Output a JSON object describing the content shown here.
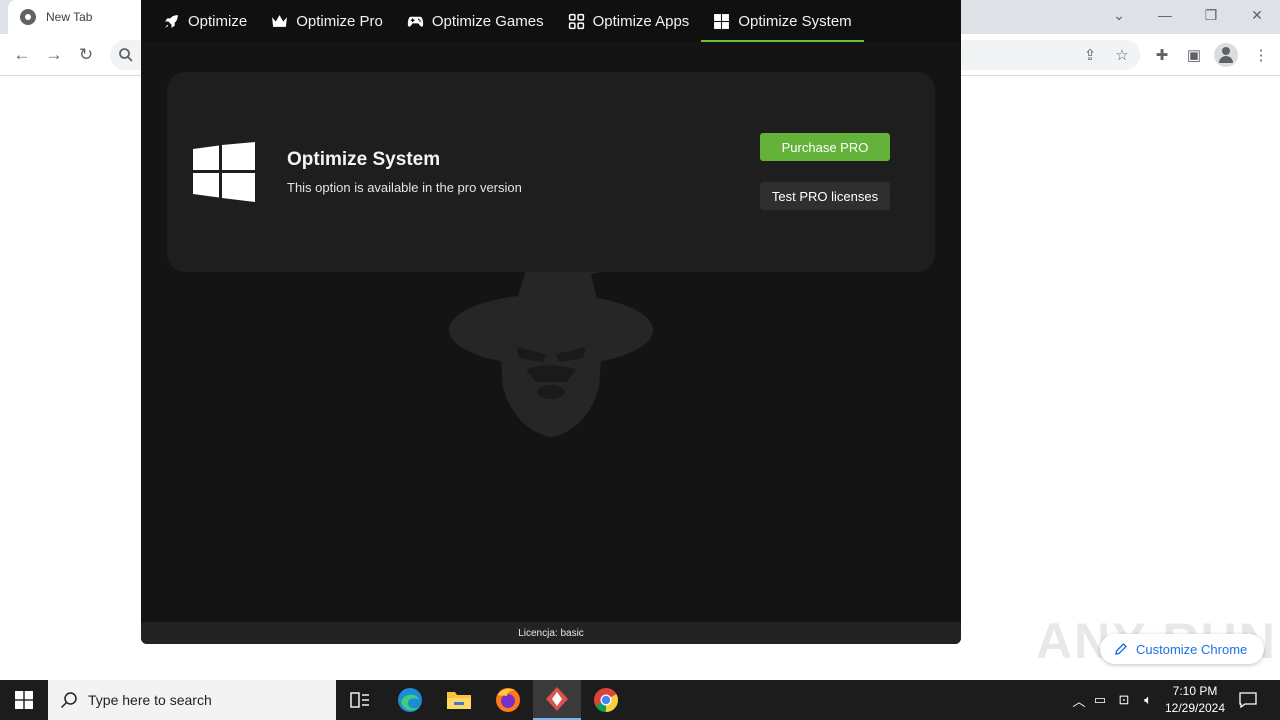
{
  "browser": {
    "tab_title": "New Tab",
    "controls": {
      "dropdown_icon": "chevron-down-icon",
      "minimize_icon": "minimize-icon",
      "restore_icon": "restore-icon",
      "close_icon": "close-icon"
    },
    "glyphs": {
      "dropdown": "⌄",
      "minimize": "—",
      "restore": "❐",
      "close": "✕",
      "back": "←",
      "forward": "→",
      "reload": "↻",
      "share": "⇪",
      "bookmark": "☆",
      "extensions": "✚",
      "sidepanel": "▣",
      "menu": "⋮"
    },
    "customize_label": "Customize Chrome"
  },
  "app": {
    "nav": [
      {
        "label": "Optimize",
        "icon": "rocket-icon"
      },
      {
        "label": "Optimize Pro",
        "icon": "crown-icon"
      },
      {
        "label": "Optimize Games",
        "icon": "gamepad-icon"
      },
      {
        "label": "Optimize Apps",
        "icon": "apps-grid-icon"
      },
      {
        "label": "Optimize System",
        "icon": "windows-icon",
        "active": true
      }
    ],
    "card": {
      "title": "Optimize System",
      "subtitle": "This option is available in the pro version",
      "purchase_label": "Purchase PRO",
      "test_label": "Test PRO licenses"
    },
    "status": "Licencja: basic",
    "accent_color": "#63b33b"
  },
  "watermark": "ANY RUN",
  "taskbar": {
    "search_placeholder": "Type here to search",
    "time": "7:10 PM",
    "date": "12/29/2024"
  }
}
